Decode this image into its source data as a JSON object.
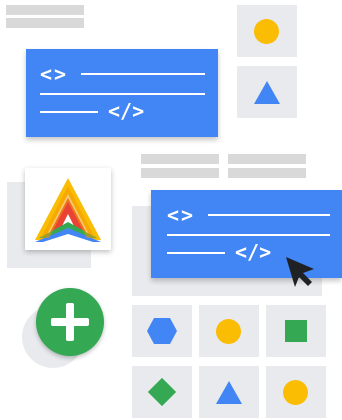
{
  "colors": {
    "blue": "#4285f4",
    "yellow": "#fbbc04",
    "green": "#34a853",
    "red": "#ea4335",
    "tile": "#e8eaed",
    "bar": "#d9d9d9",
    "cursor": "#202124"
  },
  "code_cards": [
    {
      "open_glyph": "<>",
      "close_glyph": "</>"
    },
    {
      "open_glyph": "<>",
      "close_glyph": "</>"
    }
  ],
  "add_button": {
    "glyph": "+"
  },
  "icons": {
    "logo": "tri-color-stacked-chevron-logo",
    "cursor": "mouse-pointer-icon",
    "add": "plus-icon"
  }
}
